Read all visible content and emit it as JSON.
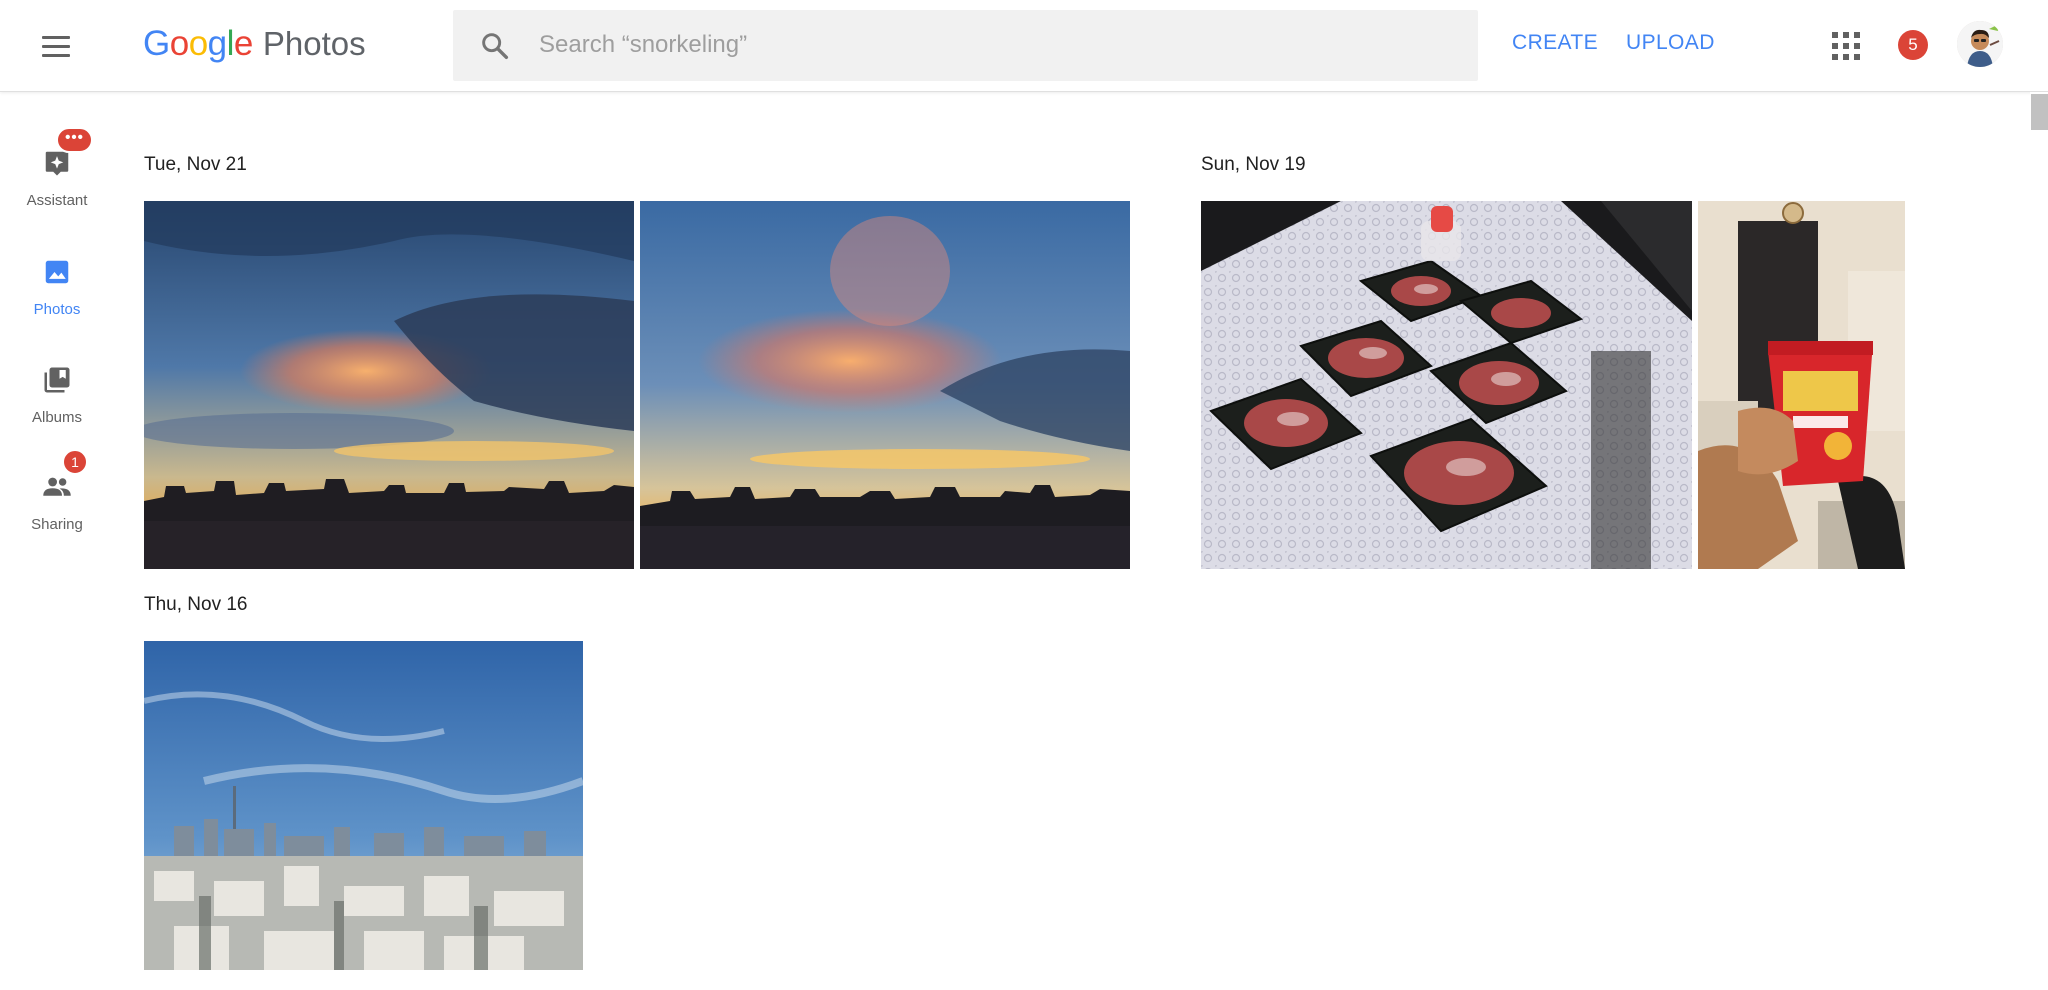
{
  "app": {
    "logo_letters": [
      "G",
      "o",
      "o",
      "g",
      "l",
      "e"
    ],
    "product_name": "Photos"
  },
  "search": {
    "placeholder": "Search “snorkeling”"
  },
  "header": {
    "create_label": "CREATE",
    "upload_label": "UPLOAD",
    "notification_count": "5"
  },
  "sidebar": {
    "items": [
      {
        "label": "Assistant",
        "icon": "assistant-icon",
        "badge": "•••"
      },
      {
        "label": "Photos",
        "icon": "photo-icon",
        "active": true
      },
      {
        "label": "Albums",
        "icon": "albums-icon"
      },
      {
        "label": "Sharing",
        "icon": "people-icon",
        "badge": "1"
      }
    ]
  },
  "groups": [
    {
      "date": "Tue, Nov 21",
      "photos": [
        "sunset-sky",
        "sunset-sky"
      ]
    },
    {
      "date": "Sun, Nov 19",
      "photos": [
        "steaks-on-table",
        "cup-noodles"
      ]
    },
    {
      "date": "Thu, Nov 16",
      "photos": [
        "city-skyline"
      ]
    }
  ],
  "colors": {
    "accent": "#4285f4",
    "badge": "#db4437",
    "text": "#212121",
    "icon": "#616161"
  }
}
